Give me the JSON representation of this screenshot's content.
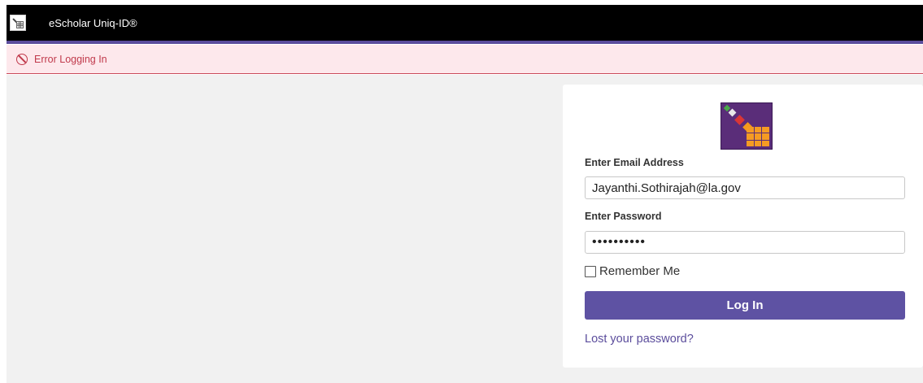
{
  "header": {
    "app_title": "eScholar Uniq-ID®",
    "logo_icon": "escholar-grid-icon"
  },
  "alert": {
    "icon": "no-entry-icon",
    "message": "Error Logging In"
  },
  "login_form": {
    "brand_logo_icon": "escholar-brand-logo",
    "email_label": "Enter Email Address",
    "email_value": "Jayanthi.Sothirajah@la.gov",
    "password_label": "Enter Password",
    "password_value": "••••••••••",
    "remember_label": "Remember Me",
    "remember_checked": false,
    "submit_label": "Log In",
    "lost_password_link": "Lost your password?"
  },
  "colors": {
    "header_bg": "#000000",
    "accent": "#5b4d9c",
    "alert_bg": "#fde8ec",
    "alert_text": "#c0394b",
    "content_bg": "#f1f1f1",
    "button_bg": "#5e52a3"
  }
}
